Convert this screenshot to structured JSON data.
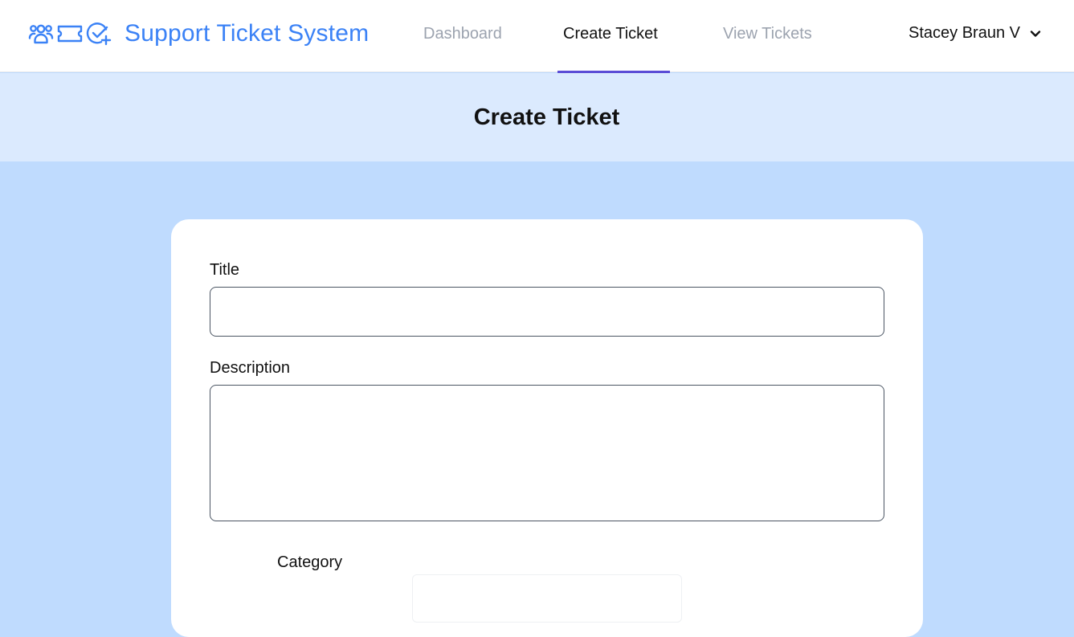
{
  "header": {
    "brand_title": "Support Ticket System",
    "brand_icons": [
      "users-icon",
      "ticket-icon",
      "check-plus-icon"
    ],
    "accent_color": "#3b82f6"
  },
  "nav": {
    "items": [
      {
        "label": "Dashboard",
        "active": false
      },
      {
        "label": "Create Ticket",
        "active": true
      },
      {
        "label": "View Tickets",
        "active": false
      }
    ],
    "active_underline_color": "#5b4dd6"
  },
  "user": {
    "name": "Stacey Braun V",
    "menu_icon": "chevron-down-icon"
  },
  "page": {
    "title": "Create Ticket"
  },
  "form": {
    "title_label": "Title",
    "title_value": "",
    "description_label": "Description",
    "description_value": "",
    "category_label": "Category",
    "category_value": ""
  }
}
